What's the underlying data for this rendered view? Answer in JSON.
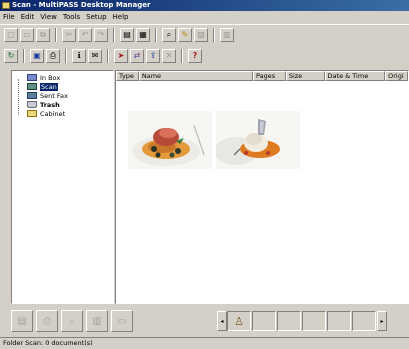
{
  "window": {
    "title": "Scan - MultiPASS Desktop Manager"
  },
  "menu": [
    "File",
    "Edit",
    "View",
    "Tools",
    "Setup",
    "Help"
  ],
  "toolbar1": [
    {
      "name": "new-icon",
      "glyph": "□"
    },
    {
      "name": "open-icon",
      "glyph": "▭"
    },
    {
      "name": "copy-icon",
      "glyph": "⧉"
    },
    {
      "name": "cut-icon",
      "glyph": "✂"
    },
    {
      "name": "rotate-left-icon",
      "glyph": "↶"
    },
    {
      "name": "rotate-right-icon",
      "glyph": "↷"
    },
    {
      "name": "pages-icon",
      "glyph": "▤"
    },
    {
      "name": "fit-page-icon",
      "glyph": "▦"
    },
    {
      "name": "zoom-icon",
      "glyph": "⌕"
    },
    {
      "name": "annotate-icon",
      "glyph": "✎"
    },
    {
      "name": "stamp-icon",
      "glyph": "▧"
    },
    {
      "name": "page-icon",
      "glyph": "▥"
    }
  ],
  "toolbar2": [
    {
      "name": "refresh-icon",
      "glyph": "↻"
    },
    {
      "name": "scan-icon",
      "glyph": "▣"
    },
    {
      "name": "print-icon",
      "glyph": "⎙"
    },
    {
      "name": "info-icon",
      "glyph": "ℹ"
    },
    {
      "name": "mail-icon",
      "glyph": "✉"
    },
    {
      "name": "send-icon",
      "glyph": "➤"
    },
    {
      "name": "receive-icon",
      "glyph": "⇄"
    },
    {
      "name": "export-icon",
      "glyph": "⇪"
    },
    {
      "name": "delete-icon",
      "glyph": "✕"
    },
    {
      "name": "help-icon",
      "glyph": "?"
    }
  ],
  "tree": {
    "items": [
      {
        "label": "In Box",
        "icon": "ico-inbox",
        "name": "inbox-icon"
      },
      {
        "label": "Scan",
        "icon": "ico-scan",
        "name": "scan-folder-icon",
        "selected": true
      },
      {
        "label": "Sent Fax",
        "icon": "ico-fax",
        "name": "sent-fax-icon"
      },
      {
        "label": "Trash",
        "icon": "ico-trash",
        "name": "trash-icon",
        "bold": true
      },
      {
        "label": "Cabinet",
        "icon": "ico-cab",
        "name": "cabinet-icon"
      }
    ]
  },
  "list": {
    "columns": [
      {
        "label": "Type",
        "width": 23
      },
      {
        "label": "Name",
        "width": 115
      },
      {
        "label": "Pages",
        "width": 33
      },
      {
        "label": "Size",
        "width": 39
      },
      {
        "label": "Date & Time",
        "width": 61
      },
      {
        "label": "Origi",
        "width": 23
      }
    ]
  },
  "bottom_buttons": [
    "fax-button",
    "print-button",
    "view-button",
    "copy-button",
    "file-button"
  ],
  "status": {
    "text": "Folder Scan: 0 document(s)"
  }
}
